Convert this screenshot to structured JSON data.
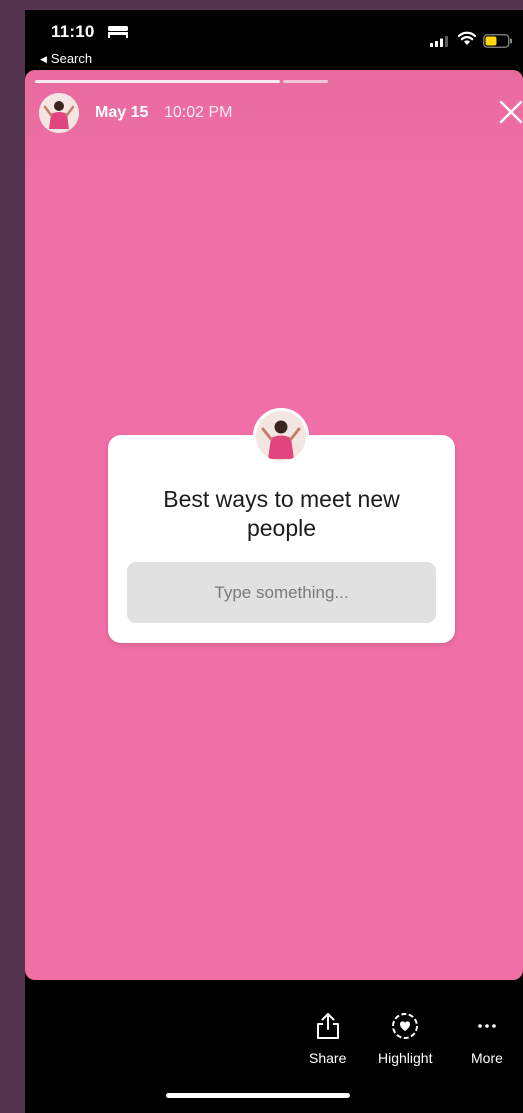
{
  "status_bar": {
    "time": "11:10",
    "back_label": "Search",
    "icons": [
      "bed-icon",
      "signal-icon",
      "wifi-icon",
      "battery-icon"
    ]
  },
  "story": {
    "date": "May 15",
    "time": "10:02 PM",
    "background_color": "#f06fa5",
    "question": "Best ways to meet new people",
    "answer_placeholder": "Type something..."
  },
  "actions": {
    "share": "Share",
    "highlight": "Highlight",
    "more": "More"
  }
}
